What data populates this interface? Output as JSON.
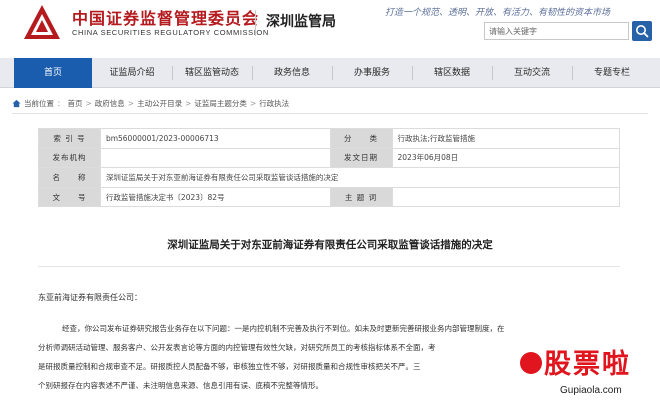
{
  "header": {
    "org_name_cn": "中国证券监督管理委员会",
    "org_name_en": "CHINA SECURITIES REGULATORY COMMISSION",
    "bureau": "深圳监管局",
    "slogan": "打造一个规范、透明、开放、有活力、有韧性的资本市场",
    "search_placeholder": "请输入关键字",
    "brand_color": "#b51a1f"
  },
  "nav": {
    "items": [
      "首页",
      "证监局介绍",
      "辖区监管动态",
      "政务信息",
      "办事服务",
      "辖区数据",
      "互动交流",
      "专题专栏"
    ],
    "active_index": 0,
    "active_color": "#1a5cae"
  },
  "breadcrumb": {
    "prefix": "当前位置",
    "items": [
      "首页",
      "政府信息",
      "主动公开目录",
      "证监局主题分类",
      "行政执法"
    ]
  },
  "info_table": {
    "labels": [
      "索 引 号",
      "分　　类",
      "发布机构",
      "发文日期",
      "名　　称",
      "文　　号",
      "主 题 词"
    ],
    "index_no": "bm56000001/2023-00006713",
    "category": "行政执法;行政监管措施",
    "publisher": "",
    "date": "2023年06月08日",
    "name": "深圳证监局关于对东亚前海证券有限责任公司采取监管谈话措施的决定",
    "doc_no": "行政监管措施决定书〔2023〕82号",
    "keywords": ""
  },
  "document": {
    "title": "深圳证监局关于对东亚前海证券有限责任公司采取监管谈话措施的决定",
    "recipient": "东亚前海证券有限责任公司：",
    "lines": [
      "经查，你公司发布证券研究报告业务存在以下问题：一是内控机制不完善及执行不到位。如未及时更新完善研报业务内部管理制度，在",
      "分析师调研活动管理、服务客户、公开发表言论等方面的内控管理有效性欠缺，对研究所员工的考核指标体系不全面，考",
      "是研报质量控制和合规审查不足。研报质控人员配备不够，审核独立性不够，对研报质量和合规性审核把关不严。三",
      "个别研报存在内容表述不严谨、未注明信息来源、信息引用有误、底稿不完整等情形。"
    ]
  },
  "watermark": {
    "text": "股票啦",
    "url": "Gupiaola.com",
    "color": "#e1151e"
  }
}
